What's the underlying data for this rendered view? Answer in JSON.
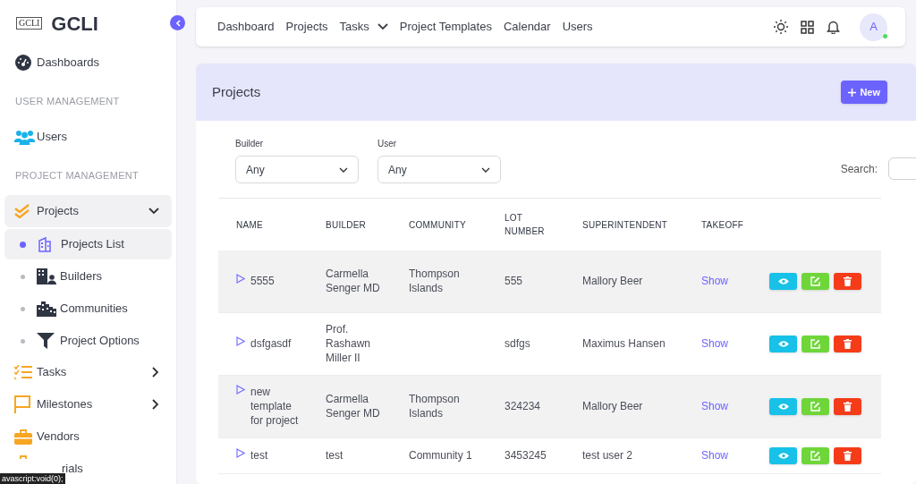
{
  "brand": {
    "logo_text": "GCLI",
    "name": "GCLI"
  },
  "sidebar": {
    "items": [
      {
        "kind": "item",
        "label": "Dashboards"
      },
      {
        "kind": "heading",
        "label": "USER MANAGEMENT"
      },
      {
        "kind": "item",
        "label": "Users"
      },
      {
        "kind": "heading",
        "label": "PROJECT MANAGEMENT"
      },
      {
        "kind": "group",
        "label": "Projects",
        "expanded": true,
        "children": [
          {
            "label": "Projects List",
            "selected": true
          },
          {
            "label": "Builders",
            "selected": false
          },
          {
            "label": "Communities",
            "selected": false
          },
          {
            "label": "Project Options",
            "selected": false
          }
        ]
      },
      {
        "kind": "group",
        "label": "Tasks",
        "expanded": false
      },
      {
        "kind": "group",
        "label": "Milestones",
        "expanded": false
      },
      {
        "kind": "item",
        "label": "Vendors"
      },
      {
        "kind": "covered",
        "label": "rials"
      }
    ]
  },
  "status_tip": "avascript:void(0);",
  "topnav": [
    {
      "label": "Dashboard",
      "dropdown": false
    },
    {
      "label": "Projects",
      "dropdown": false
    },
    {
      "label": "Tasks",
      "dropdown": true
    },
    {
      "label": "Project Templates",
      "dropdown": false
    },
    {
      "label": "Calendar",
      "dropdown": false
    },
    {
      "label": "Users",
      "dropdown": false
    }
  ],
  "avatar": {
    "initial": "A",
    "online": true
  },
  "card": {
    "title": "Projects",
    "new_button": "New"
  },
  "filters": [
    {
      "label": "Builder",
      "value": "Any"
    },
    {
      "label": "User",
      "value": "Any"
    }
  ],
  "search": {
    "label": "Search:"
  },
  "table": {
    "columns": [
      "NAME",
      "BUILDER",
      "COMMUNITY",
      "LOT NUMBER",
      "SUPERINTENDENT",
      "TAKEOFF"
    ],
    "rows": [
      {
        "cells": [
          "5555",
          "Carmella Senger MD",
          "Thompson Islands",
          "555",
          "Mallory Beer"
        ],
        "takeoff": "Show",
        "striped": true
      },
      {
        "cells": [
          "dsfgasdf",
          "Prof. Rashawn Miller II",
          "",
          "sdfgs",
          "Maximus Hansen"
        ],
        "takeoff": "Show",
        "striped": false
      },
      {
        "cells": [
          "new template for project",
          "Carmella Senger MD",
          "Thompson Islands",
          "324234",
          "Mallory Beer"
        ],
        "takeoff": "Show",
        "striped": true
      },
      {
        "cells": [
          "test",
          "test",
          "Community 1",
          "3453245",
          "test user 2"
        ],
        "takeoff": "Show",
        "striped": false
      }
    ]
  }
}
